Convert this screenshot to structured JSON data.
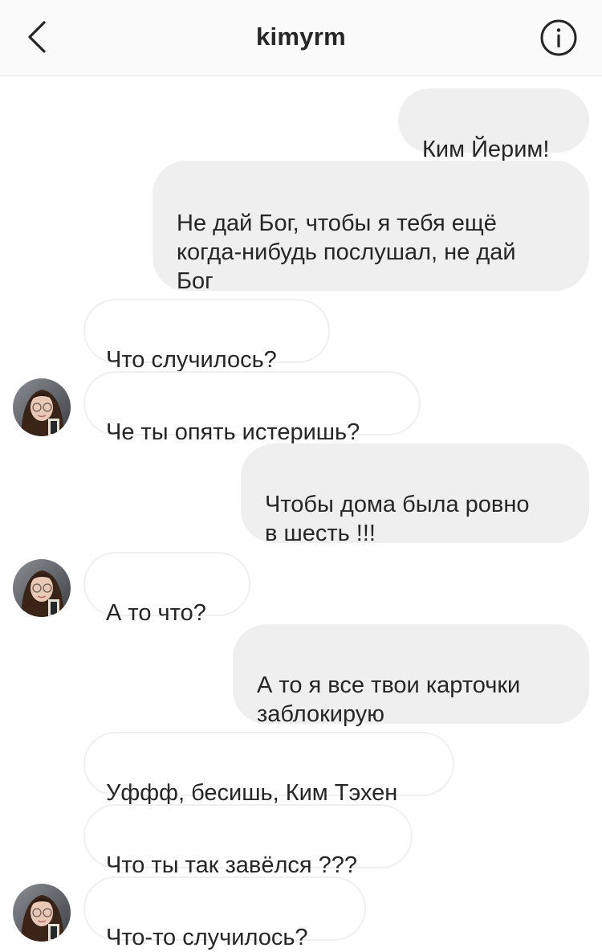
{
  "header": {
    "title": "kimyrm",
    "back_icon": "chevron-left-icon",
    "info_icon": "info-circle-icon"
  },
  "messages": [
    {
      "side": "out",
      "text": "Ким Йерим!"
    },
    {
      "side": "out",
      "text": "Не дай Бог, чтобы я тебя ещё\nкогда-нибудь послушал, не дай\nБог"
    },
    {
      "side": "in",
      "text": "Что случилось?"
    },
    {
      "side": "in",
      "text": "Че ты опять истеришь?"
    },
    {
      "side": "out",
      "text": "Чтобы дома была ровно\nв шесть !!!"
    },
    {
      "side": "in",
      "text": "А то что?"
    },
    {
      "side": "out",
      "text": "А то я все твои карточки\nзаблокирую",
      "emoji": "💪"
    },
    {
      "side": "in",
      "text": "Уффф, бесишь, Ким Тэхен"
    },
    {
      "side": "in",
      "text": "Что ты так завёлся ???"
    },
    {
      "side": "in",
      "text": "Что-то случилось?"
    }
  ],
  "colors": {
    "outgoing_bubble": "#efefef",
    "incoming_border": "#efefef",
    "header_bg": "#fafafa",
    "text": "#262626"
  }
}
